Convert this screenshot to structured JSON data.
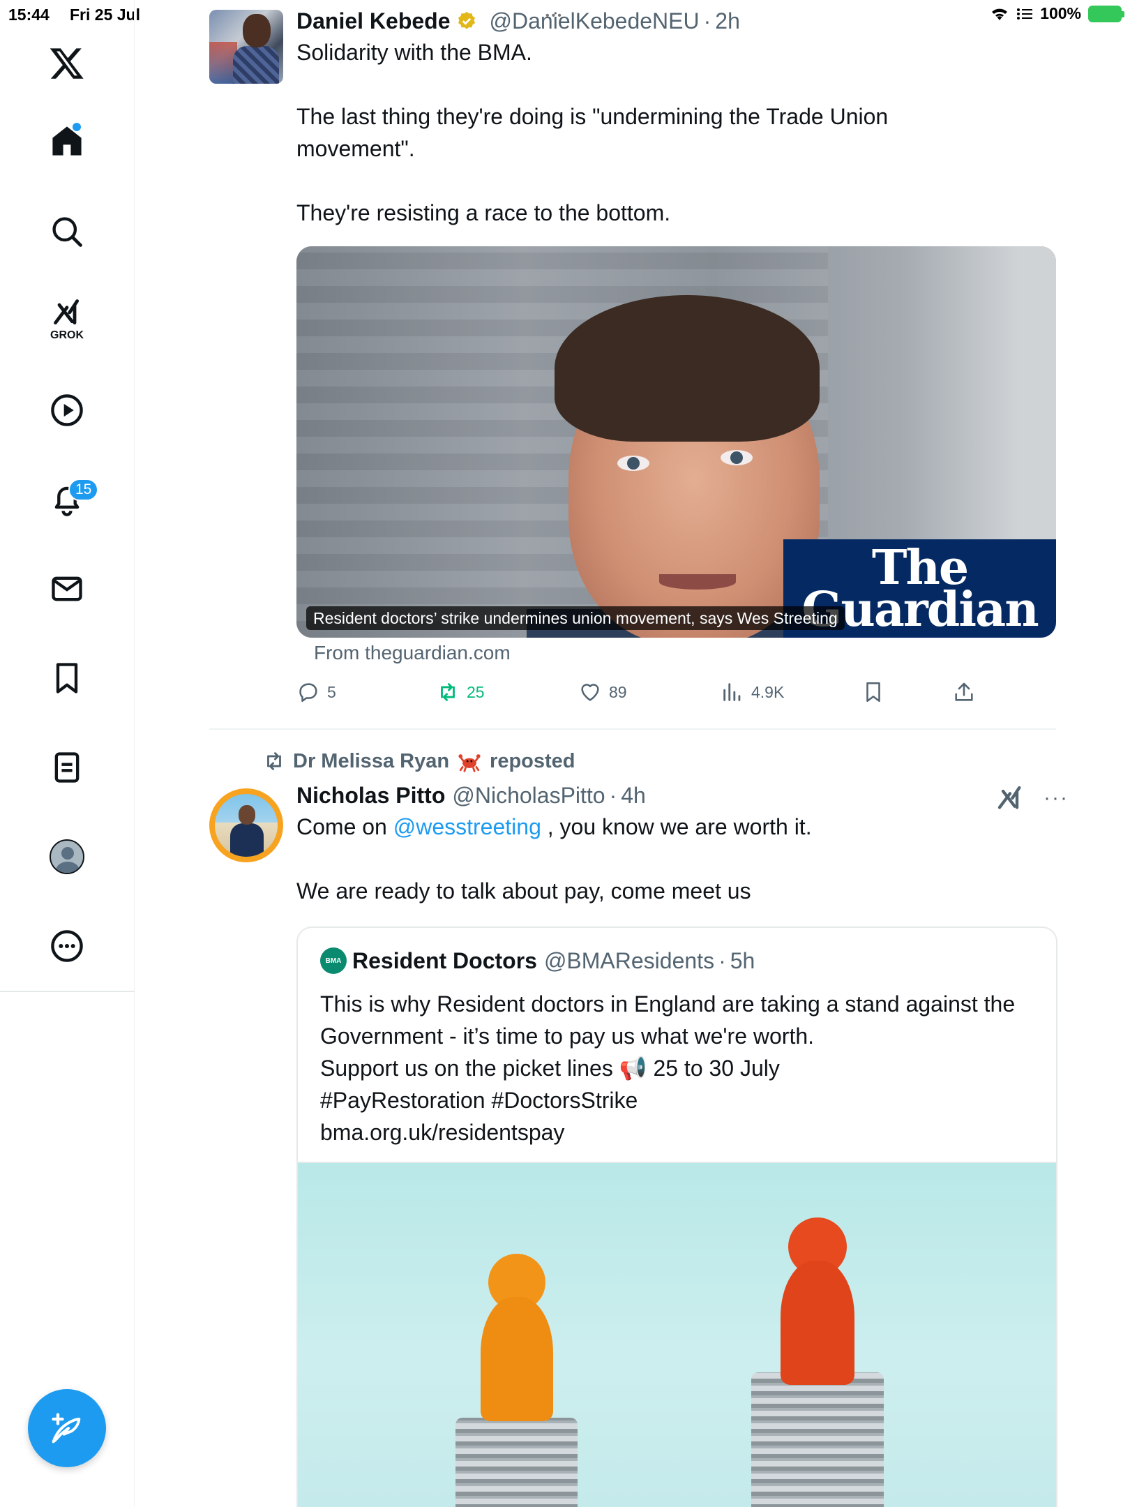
{
  "status_bar": {
    "time": "15:44",
    "date": "Fri 25 Jul",
    "battery": "100%"
  },
  "sidebar": {
    "items": [
      {
        "name": "home",
        "icon": "home-icon"
      },
      {
        "name": "explore",
        "icon": "search-icon"
      },
      {
        "name": "grok",
        "icon": "grok-icon",
        "label": "GROK"
      },
      {
        "name": "videos",
        "icon": "play-icon"
      },
      {
        "name": "notifications",
        "icon": "bell-icon",
        "badge": "15"
      },
      {
        "name": "messages",
        "icon": "mail-icon"
      },
      {
        "name": "bookmarks",
        "icon": "bookmark-icon"
      },
      {
        "name": "lists",
        "icon": "list-icon"
      },
      {
        "name": "profile",
        "icon": "avatar-icon"
      },
      {
        "name": "more",
        "icon": "more-icon"
      }
    ],
    "compose_icon": "compose-icon"
  },
  "tweet1": {
    "author": "Daniel Kebede",
    "handle": "@DanielKebedeNEU",
    "time": "2h",
    "lines": [
      "Solidarity with the BMA.",
      "",
      "The last thing they're doing is \"undermining the Trade Union movement\".",
      "",
      "They're resisting a race to the bottom."
    ],
    "card": {
      "brand_line1": "The",
      "brand_line2": "Guardian",
      "caption": "Resident doctors’ strike undermines union movement, says Wes Streeting",
      "source": "From theguardian.com"
    },
    "actions": {
      "replies": "5",
      "reposts": "25",
      "likes": "89",
      "views": "4.9K"
    }
  },
  "tweet2": {
    "reposted_by": "Dr Melissa Ryan",
    "reposted_suffix": "reposted",
    "author": "Nicholas Pitto",
    "handle": "@NicholasPitto",
    "time": "4h",
    "text_prefix": "Come on ",
    "mention": "@wesstreeting",
    "text_suffix": " , you know we are worth it.",
    "line3": "We are ready to talk about pay, come meet us",
    "more": "···",
    "quote": {
      "logo_text": "BMA",
      "author": "Resident Doctors",
      "handle": "@BMAResidents",
      "time": "5h",
      "lines": [
        "This is why Resident doctors in England are taking a stand against the Government - it’s time to pay us what we're worth.",
        "Support us on the picket lines 📢 25 to 30 July",
        "#PayRestoration #DoctorsStrike",
        "bma.org.uk/residentspay"
      ]
    }
  },
  "colors": {
    "accent": "#1d9bf0",
    "repost_green": "#00ba7c",
    "secondary_text": "#536471",
    "guardian_blue": "#052962"
  }
}
